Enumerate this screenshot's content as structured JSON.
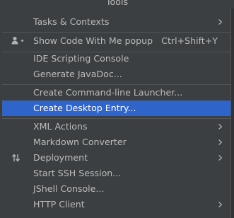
{
  "menubar": {
    "title": "Tools"
  },
  "menu": {
    "items": [
      {
        "label": "Tasks & Contexts",
        "submenu": true
      },
      {
        "label": "Show Code With Me popup",
        "shortcut": "Ctrl+Shift+Y",
        "icon": "user-dropdown-icon"
      },
      {
        "label": "IDE Scripting Console"
      },
      {
        "label": "Generate JavaDoc..."
      },
      {
        "label": "Create Command-line Launcher..."
      },
      {
        "label": "Create Desktop Entry...",
        "selected": true
      },
      {
        "label": "XML Actions",
        "submenu": true
      },
      {
        "label": "Markdown Converter",
        "submenu": true
      },
      {
        "label": "Deployment",
        "submenu": true,
        "icon": "deployment-arrows-icon"
      },
      {
        "label": "Start SSH Session..."
      },
      {
        "label": "JShell Console..."
      },
      {
        "label": "HTTP Client",
        "submenu": true
      }
    ]
  },
  "colors": {
    "background": "#3c3f41",
    "selection": "#2f65ca",
    "text": "#bbbbbb",
    "separator": "#515658"
  }
}
